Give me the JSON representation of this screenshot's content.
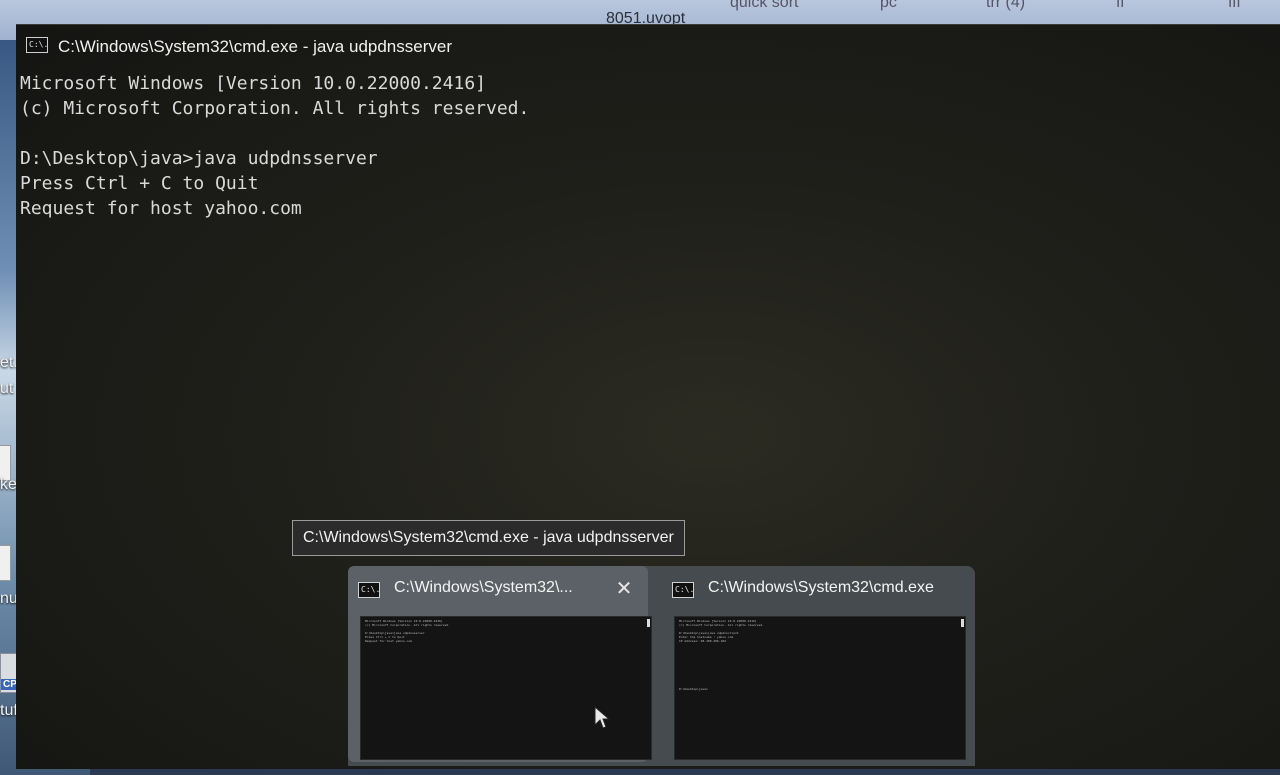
{
  "desktop": {
    "top_labels": [
      "8051.uvopt",
      "quick sort",
      "pc",
      "trr (4)",
      "ff",
      "fff"
    ],
    "left_labels": [
      "et...",
      "ut",
      "ket... tc",
      "nu",
      "CPP",
      "tuffing"
    ]
  },
  "console": {
    "title": "C:\\Windows\\System32\\cmd.exe - java  udpdnsserver",
    "icon_text": "C:\\.",
    "lines": [
      "Microsoft Windows [Version 10.0.22000.2416]",
      "(c) Microsoft Corporation. All rights reserved.",
      "",
      "D:\\Desktop\\java>java udpdnsserver",
      "Press Ctrl + C to Quit",
      "Request for host yahoo.com"
    ]
  },
  "tooltip": {
    "text": "C:\\Windows\\System32\\cmd.exe - java  udpdnsserver"
  },
  "flyout": {
    "thumbnails": [
      {
        "title": "C:\\Windows\\System32\\...",
        "close_label": "✕",
        "preview": "Microsoft Windows [Version 10.0.22000.2416]\n(c) Microsoft Corporation. All rights reserved.\n\nD:\\Desktop\\java>java udpdnsserver\nPress Ctrl + C to Quit\nRequest for host yahoo.com"
      },
      {
        "title": "C:\\Windows\\System32\\cmd.exe",
        "preview": "Microsoft Windows [Version 10.0.22000.2416]\n(c) Microsoft Corporation. All rights reserved.\n\nD:\\Desktop\\java>java udpdnsclient\nEnter the hostname : yahoo.com\nIP Address: 68.180.206.184\n\n\n\n\n\n\n\n\n\n\n\nD:\\Desktop\\java>"
      }
    ]
  }
}
